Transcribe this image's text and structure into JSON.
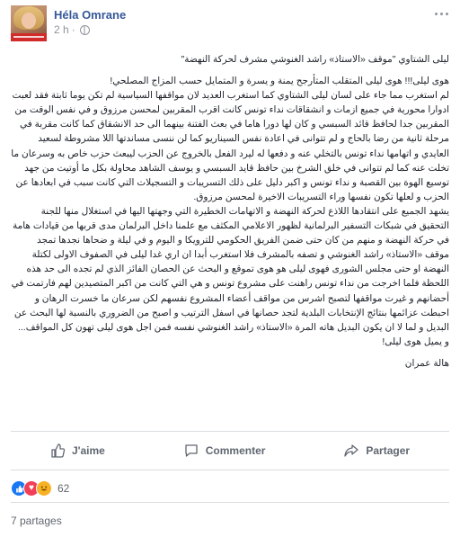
{
  "post": {
    "author": "Héla Omrane",
    "time": "2 h",
    "body": [
      "ليلى الشتاوي \"موقف «الاستاذ» راشد الغنوشي مشرف لحركة النهضة\"",
      "هوى ليلى!!! هوى ليلى المتقلب المتأرجح يمنة و يسرة و المتمايل حسب المزاج المصلحي!",
      "لم استغرب مما جاء على لسان ليلى الشتاوي كما استغرب العديد لان مواقفها السياسية لم تكن يوما ثابتة فقد لعبت ادوارا محورية في جميع ازمات و انشقاقات نداء تونس كانت اقرب المقربين لمحسن مرزوق و في نفس الوقت من المقربين جدا لحافظ قائد السبسي و كان لها دورا هاما في بعث الفتنة بينهما الى حد الانشقاق كما كانت مقربة في مرحلة ثانية من رضا بالحاج و لم تتوانى في اعادة نفس السيناريو كما لن ننسى مساندتها اللا مشروطة لسعيد العايدي و اتهامها نداء تونس بالتخلي عنه و دفعها له ليرد الفعل بالخروج عن الحزب ليبعث حزب خاص به وسرعان ما تخلت عنه كما لم تتوانى في خلق الشرخ بين حافظ قايد السبسي و يوسف الشاهد محاولة بكل ما أوتيت من جهد توسيع الهوة بين القصبة و نداء تونس و اكبر دليل على ذلك التسريبات و التسجيلات التي كانت سبب في ابعادها عن الحزب و لعلها تكون نفسها وراء التسريبات الاخيرة لمحسن مرزوق.",
      "يشهد الجميع على انتقادها اللاذع لحركة النهضة و الاتهامات الخطيرة التي وجهتها اليها في استغلال منها للجنة التحقيق في شبكات التسفير البرلمانية لظهور الاعلامي المكثف مع علمنا داخل البرلمان مدى قربها من قيادات هامة في حركة النهضة و منهم من كان حتى ضمن الفريق الحكومي للترويكا و اليوم و في ليلة و ضحاها نجدها تمجد موقف «الاستاذ» راشد الغنوشي و تصفه بالمشرف فلا استغرب أبدا ان اري غدا ليلى في الصفوف الاولى لكتلة النهضة او حتى مجلس الشورى فهوى ليلى هو هوى تموقع و البحث عن الحصان الفائز الذي لم تجده الى حد هذه اللحظة فلما اخرجت من نداء تونس راهنت على مشروع تونس و هي التي كانت من اكبر المتصيدين لهم فارتمت في أحضانهم و غيرت مواقفها لتصبح اشرس من مواقف أعضاء المشروع نفسهم لكن سرعان ما خسرت الرهان و احبطت عزائمها بنتائج الإنتخابات البلدية لتجد حصانها في اسفل الترتيب و اصبح من الضروري بالنسبة لها البحث عن البديل و لما لا ان يكون البديل هاته المرة «الاستاذ» راشد الغنوشي نفسه فمن اجل هوى ليلى تهون كل المواقف... و يميل هوى ليلى!",
      "هالة عمران"
    ]
  },
  "actions": {
    "like": "J'aime",
    "comment": "Commenter",
    "share": "Partager"
  },
  "reactions": {
    "count": "62",
    "types": [
      "like-icon",
      "love-icon",
      "haha-icon"
    ]
  },
  "shares": "7 partages",
  "colors": {
    "link": "#365899",
    "muted": "#90949c",
    "like": "#1877f2",
    "love": "#f33e58",
    "haha": "#f7b125"
  }
}
